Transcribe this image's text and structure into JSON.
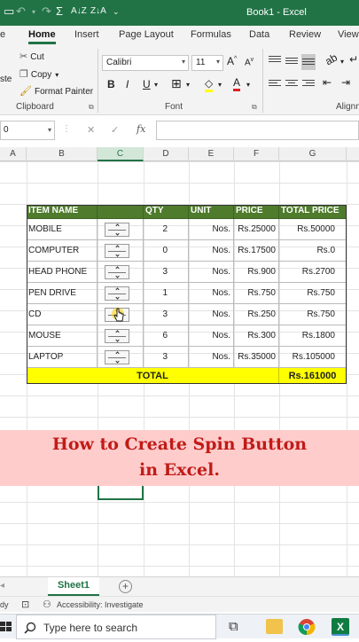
{
  "window": {
    "title": "Book1  -  Excel",
    "title_bar_color": "#217346"
  },
  "quick_access": {
    "autosum": "Σ",
    "sort_az": "A↓Z",
    "sort_za": "Z↓A"
  },
  "ribbon_tabs": [
    "e",
    "Home",
    "Insert",
    "Page Layout",
    "Formulas",
    "Data",
    "Review",
    "View"
  ],
  "active_tab": "Home",
  "clipboard": {
    "cut": "Cut",
    "copy": "Copy",
    "format_painter": "Format Painter",
    "paste_fragment": "ste",
    "group_label": "Clipboard"
  },
  "font": {
    "family": "Calibri",
    "size": "11",
    "grow": "A",
    "shrink": "A",
    "bold": "B",
    "italic": "I",
    "underline": "U",
    "fill": "◇",
    "color": "A",
    "group_label": "Font"
  },
  "alignment": {
    "group_label": "Alignm"
  },
  "formula_bar": {
    "name_box": "0",
    "fx": "fx",
    "cancel": "✕",
    "enter": "✓",
    "value": ""
  },
  "columns": [
    "A",
    "B",
    "C",
    "D",
    "E",
    "F",
    "G"
  ],
  "selected_column": "C",
  "table": {
    "headers": [
      "ITEM NAME",
      "",
      "QTY",
      "UNIT",
      "PRICE",
      "TOTAL PRICE"
    ],
    "rows": [
      [
        "MOBILE",
        "2",
        "Nos.",
        "Rs.25000",
        "Rs.50000"
      ],
      [
        "COMPUTER",
        "0",
        "Nos.",
        "Rs.17500",
        "Rs.0"
      ],
      [
        "HEAD PHONE",
        "3",
        "Nos.",
        "Rs.900",
        "Rs.2700"
      ],
      [
        "PEN DRIVE",
        "1",
        "Nos.",
        "Rs.750",
        "Rs.750"
      ],
      [
        "CD",
        "3",
        "Nos.",
        "Rs.250",
        "Rs.750"
      ],
      [
        "MOUSE",
        "6",
        "Nos.",
        "Rs.300",
        "Rs.1800"
      ],
      [
        "LAPTOP",
        "3",
        "Nos.",
        "Rs.35000",
        "Rs.105000"
      ]
    ],
    "total_label": "TOTAL",
    "total_value": "Rs.161000",
    "header_color": "#4e7b2c",
    "total_color": "#ffff00"
  },
  "banner": {
    "line1": "How to Create Spin Button",
    "line2": "in Excel.",
    "background": "#ffcccc",
    "text_color": "#c11b17"
  },
  "sheet": {
    "tab": "Sheet1",
    "add": "+"
  },
  "status": {
    "ready_fragment": "dy",
    "accessibility": "Accessibility: Investigate"
  },
  "taskbar": {
    "search_placeholder": "Type here to search"
  }
}
